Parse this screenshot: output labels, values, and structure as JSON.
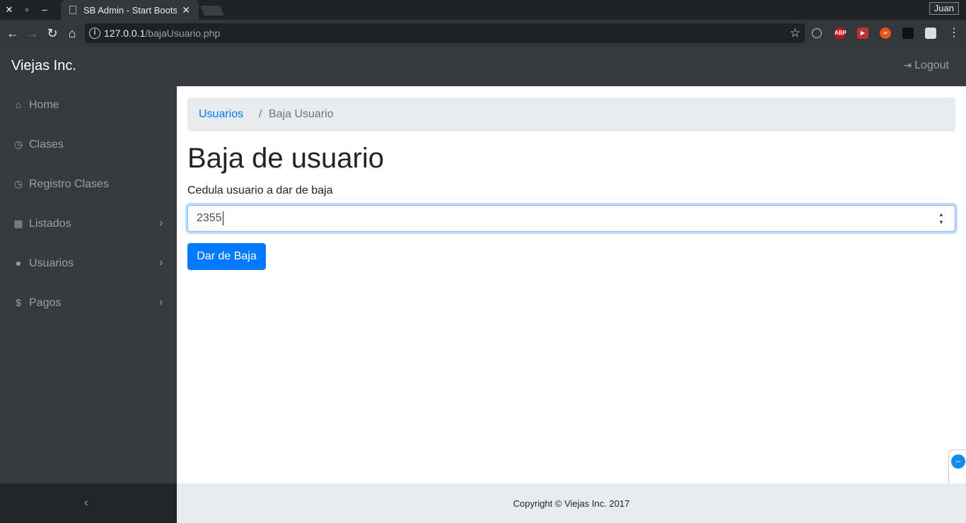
{
  "browser": {
    "tab_title": "SB Admin - Start Bootstrap Admin Template",
    "profile_name": "Juan",
    "url_host": "127.0.0.1",
    "url_path": "/bajaUsuario.php",
    "extensions": [
      {
        "name": "adblock",
        "label": "ABP",
        "color": "#c5121c"
      },
      {
        "name": "youtube",
        "label": "▶",
        "color": "#b33"
      },
      {
        "name": "infinity",
        "label": "∞",
        "color": "#e8541c"
      },
      {
        "name": "gnome",
        "label": "",
        "color": "#222"
      },
      {
        "name": "cube",
        "label": "",
        "color": "#ddd"
      }
    ]
  },
  "navbar": {
    "brand": "Viejas Inc.",
    "logout_label": "Logout"
  },
  "sidebar": {
    "items": [
      {
        "label": "Home",
        "icon": "home-icon",
        "has_submenu": false
      },
      {
        "label": "Clases",
        "icon": "clock-icon",
        "has_submenu": false
      },
      {
        "label": "Registro Clases",
        "icon": "clock-icon",
        "has_submenu": false
      },
      {
        "label": "Listados",
        "icon": "table-icon",
        "has_submenu": true
      },
      {
        "label": "Usuarios",
        "icon": "user-icon",
        "has_submenu": true
      },
      {
        "label": "Pagos",
        "icon": "dollar-icon",
        "has_submenu": true
      }
    ]
  },
  "breadcrumb": {
    "link": "Usuarios",
    "separator": "/",
    "active": "Baja Usuario"
  },
  "main": {
    "title": "Baja de usuario",
    "field_label": "Cedula usuario a dar de baja",
    "field_value": "2355",
    "submit_label": "Dar de Baja"
  },
  "footer": {
    "copyright": "Copyright © Viejas Inc. 2017"
  },
  "colors": {
    "primary": "#007bff",
    "dark": "#343a40",
    "light": "#e9ecef"
  }
}
